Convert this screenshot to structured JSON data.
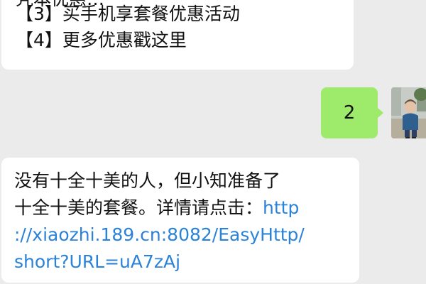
{
  "messages": {
    "m1": {
      "partial_line": "凭本优惠…",
      "line3": "【3】买手机享套餐优惠活动",
      "line4": "【4】更多优惠戳这里"
    },
    "m2": {
      "text": "2"
    },
    "m3": {
      "line1": "没有十全十美的人，但小知准备了",
      "line2_text": "十全十美的套餐。详情请点击：",
      "link_part1": "http",
      "link_part2": "://xiaozhi.189.cn:8082/EasyHttp/",
      "link_part3": "short?URL=uA7zAj"
    }
  },
  "colors": {
    "chat_background": "#ebebeb",
    "incoming_bubble": "#ffffff",
    "outgoing_bubble": "#9eea6a",
    "link": "#2b82d9"
  },
  "avatar": {
    "icon": "user-avatar-photo"
  }
}
